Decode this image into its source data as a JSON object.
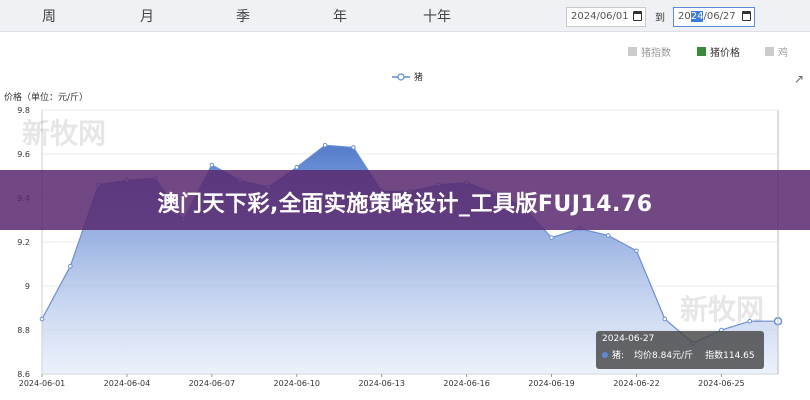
{
  "tabs": [
    "周",
    "月",
    "季",
    "年",
    "十年"
  ],
  "date_range": {
    "start": "2024/06/01",
    "separator": "到",
    "end_prefix": "20",
    "end_selected": "24",
    "end_suffix": "/06/27"
  },
  "top_legend": [
    {
      "label": "猪指数",
      "color": "#cccccc",
      "active": false
    },
    {
      "label": "猪价格",
      "color": "#3a8a3a",
      "active": true
    },
    {
      "label": "鸡",
      "color": "#cccccc",
      "active": false
    }
  ],
  "series_legend": {
    "label": "猪",
    "color": "#5b8bd8"
  },
  "watermark": "新牧网",
  "chart_data": {
    "type": "area",
    "ylabel": "价格（单位：元/斤）",
    "ylim": [
      8.6,
      9.8
    ],
    "yticks": [
      "8.6",
      "8.8",
      "9",
      "9.2",
      "9.4",
      "9.6",
      "9.8"
    ],
    "xticks": [
      "2024-06-01",
      "2024-06-04",
      "2024-06-07",
      "2024-06-10",
      "2024-06-13",
      "2024-06-16",
      "2024-06-19",
      "2024-06-22",
      "2024-06-25"
    ],
    "series": [
      {
        "name": "猪",
        "x": [
          "2024-06-01",
          "2024-06-02",
          "2024-06-03",
          "2024-06-04",
          "2024-06-05",
          "2024-06-06",
          "2024-06-07",
          "2024-06-08",
          "2024-06-09",
          "2024-06-10",
          "2024-06-11",
          "2024-06-12",
          "2024-06-13",
          "2024-06-14",
          "2024-06-15",
          "2024-06-16",
          "2024-06-17",
          "2024-06-18",
          "2024-06-19",
          "2024-06-20",
          "2024-06-21",
          "2024-06-22",
          "2024-06-23",
          "2024-06-24",
          "2024-06-25",
          "2024-06-26",
          "2024-06-27"
        ],
        "values": [
          8.85,
          9.09,
          9.46,
          9.48,
          9.49,
          9.3,
          9.55,
          9.48,
          9.45,
          9.54,
          9.64,
          9.63,
          9.43,
          9.43,
          9.46,
          9.47,
          9.42,
          9.36,
          9.22,
          9.26,
          9.23,
          9.16,
          8.85,
          8.74,
          8.8,
          8.84,
          8.84
        ]
      }
    ],
    "highlight_index": 26
  },
  "tooltip": {
    "date": "2024-06-27",
    "series": "猪:",
    "avg_price": "均价8.84元/斤",
    "index": "指数114.65"
  },
  "banner": {
    "title": "澳门天下彩,全面实施策略设计_工具版FUJ14.76"
  }
}
